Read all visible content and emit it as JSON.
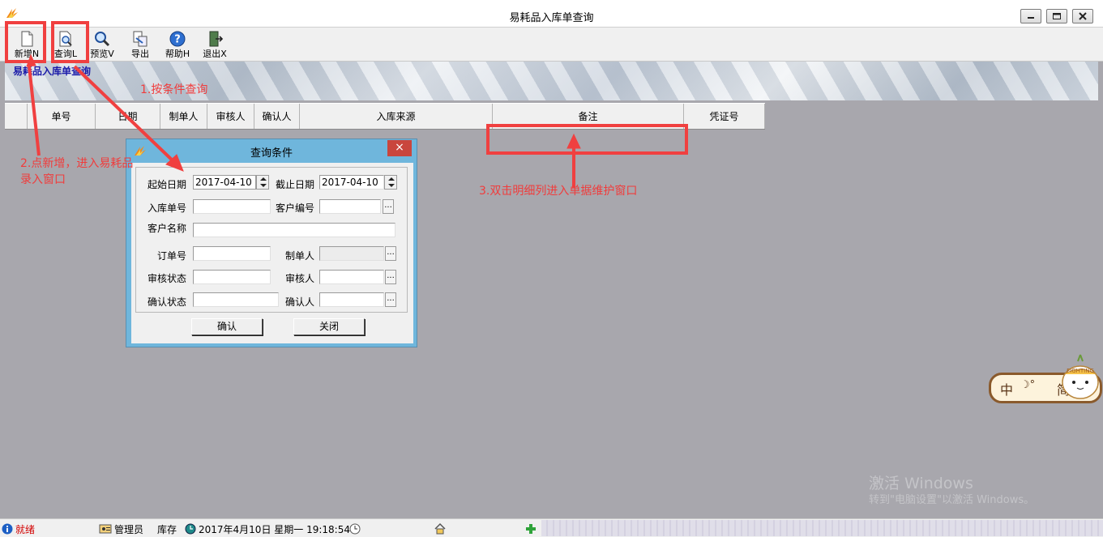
{
  "window": {
    "title": "易耗品入库单查询"
  },
  "toolbar": {
    "buttons": [
      {
        "label": "新增N",
        "icon": "new-document-icon"
      },
      {
        "label": "查询L",
        "icon": "query-magnifier-page-icon"
      },
      {
        "label": "预览V",
        "icon": "preview-magnifier-icon"
      },
      {
        "label": "导出",
        "icon": "export-icon"
      },
      {
        "label": "帮助H",
        "icon": "help-icon"
      },
      {
        "label": "退出X",
        "icon": "exit-door-icon"
      }
    ]
  },
  "banner": {
    "title": "易耗品入库单查询"
  },
  "grid": {
    "columns": [
      "",
      "单号",
      "日期",
      "制单人",
      "审核人",
      "确认人",
      "入库来源",
      "备注",
      "凭证号"
    ]
  },
  "dialog": {
    "title": "查询条件",
    "close": "×",
    "start_date_label": "起始日期",
    "start_date": "2017-04-10",
    "end_date_label": "截止日期",
    "end_date": "2017-04-10",
    "order_no_label": "入库单号",
    "order_no": "",
    "customer_no_label": "客户编号",
    "customer_no": "",
    "customer_name_label": "客户名称",
    "customer_name": "",
    "po_no_label": "订单号",
    "po_no": "",
    "maker_label": "制单人",
    "maker": "",
    "audit_status_label": "审核状态",
    "audit_status": "",
    "auditor_label": "审核人",
    "auditor": "",
    "confirm_status_label": "确认状态",
    "confirm_status": "",
    "confirmer_label": "确认人",
    "confirmer": "",
    "ellipsis": "...",
    "ok_label": "确认",
    "close_label": "关闭"
  },
  "annotations": {
    "step1": "1.按条件查询",
    "step2_line1": "2.点新增，进入易耗品",
    "step2_line2": "录入窗口",
    "step3": "3.双击明细列进入单据维护窗口"
  },
  "statusbar": {
    "ready": "就绪",
    "user": "管理员",
    "module": "库存",
    "datetime": "2017年4月10日 星期一 19:18:54"
  },
  "ime": {
    "zh": "中",
    "moon": "☽°",
    "simplified": "简",
    "badge": "FIGHTING"
  },
  "watermark": {
    "line1": "激活 Windows",
    "line2": "转到\"电脑设置\"以激活 Windows。"
  },
  "colors": {
    "annotation": "#f04040",
    "banner_title": "#1a1aa8",
    "dialog_frame": "#6fb6dc",
    "background": "#a8a7ad"
  }
}
